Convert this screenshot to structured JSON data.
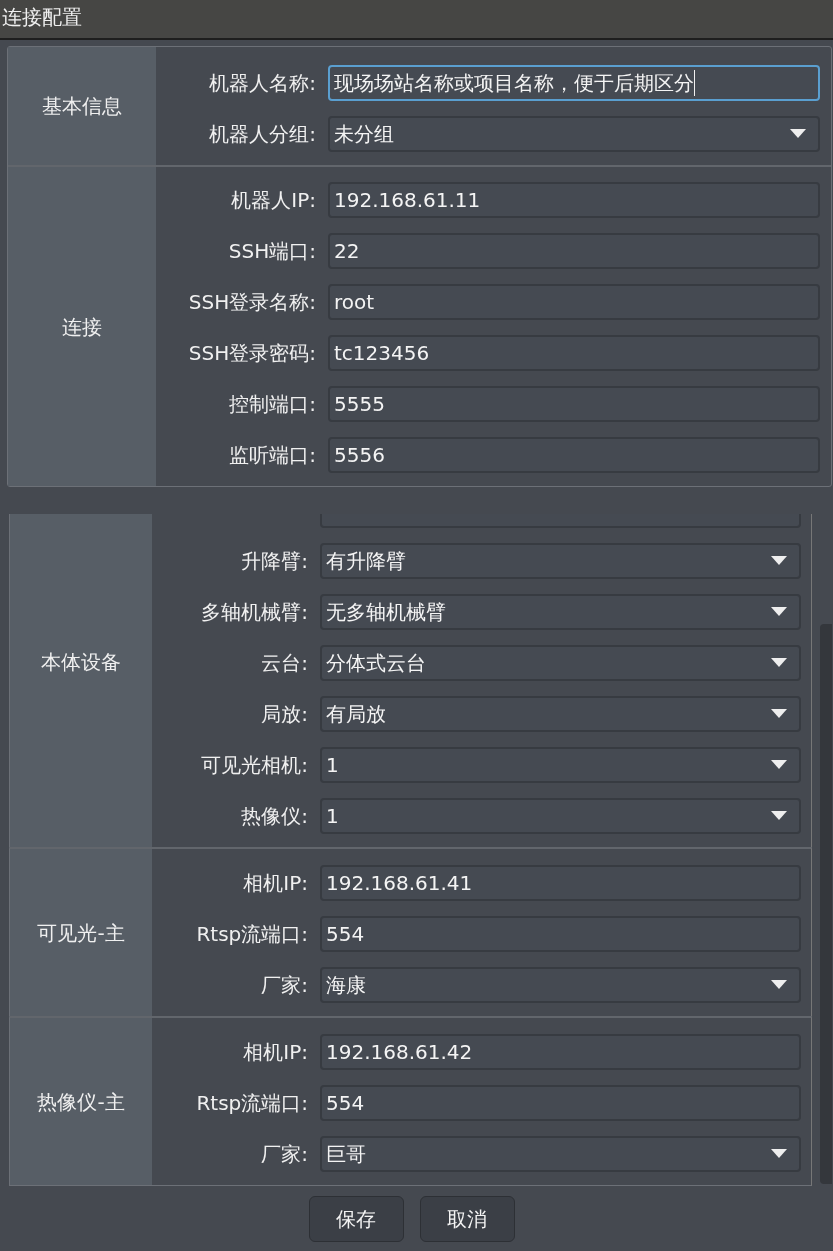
{
  "window": {
    "title": "连接配置"
  },
  "top_sections": [
    {
      "title": "基本信息",
      "fields": [
        {
          "label": "机器人名称:",
          "kind": "text",
          "value": "现场场站名称或项目名称，便于后期区分",
          "focused": true
        },
        {
          "label": "机器人分组:",
          "kind": "select",
          "value": "未分组",
          "focused": false
        }
      ]
    },
    {
      "title": "连接",
      "fields": [
        {
          "label": "机器人IP:",
          "kind": "text",
          "value": "192.168.61.11",
          "focused": false
        },
        {
          "label": "SSH端口:",
          "kind": "text",
          "value": "22",
          "focused": false
        },
        {
          "label": "SSH登录名称:",
          "kind": "text",
          "value": "root",
          "focused": false
        },
        {
          "label": "SSH登录密码:",
          "kind": "text",
          "value": "tc123456",
          "focused": false
        },
        {
          "label": "控制端口:",
          "kind": "text",
          "value": "5555",
          "focused": false
        },
        {
          "label": "监听端口:",
          "kind": "text",
          "value": "5556",
          "focused": false
        }
      ]
    }
  ],
  "scroll_sections": [
    {
      "title": "本体设备",
      "fields": [
        {
          "kind": "cut"
        },
        {
          "label": "升降臂:",
          "kind": "select",
          "value": "有升降臂",
          "focused": false
        },
        {
          "label": "多轴机械臂:",
          "kind": "select",
          "value": "无多轴机械臂",
          "focused": false
        },
        {
          "label": "云台:",
          "kind": "select",
          "value": "分体式云台",
          "focused": false
        },
        {
          "label": "局放:",
          "kind": "select",
          "value": "有局放",
          "focused": false
        },
        {
          "label": "可见光相机:",
          "kind": "select",
          "value": "1",
          "focused": false
        },
        {
          "label": "热像仪:",
          "kind": "select",
          "value": "1",
          "focused": false
        }
      ]
    },
    {
      "title": "可见光-主",
      "fields": [
        {
          "label": "相机IP:",
          "kind": "text",
          "value": "192.168.61.41",
          "focused": false
        },
        {
          "label": "Rtsp流端口:",
          "kind": "text",
          "value": "554",
          "focused": false
        },
        {
          "label": "厂家:",
          "kind": "select",
          "value": "海康",
          "focused": false
        }
      ]
    },
    {
      "title": "热像仪-主",
      "fields": [
        {
          "label": "相机IP:",
          "kind": "text",
          "value": "192.168.61.42",
          "focused": false
        },
        {
          "label": "Rtsp流端口:",
          "kind": "text",
          "value": "554",
          "focused": false
        },
        {
          "label": "厂家:",
          "kind": "select",
          "value": "巨哥",
          "focused": false
        }
      ]
    }
  ],
  "buttons": [
    "保存",
    "取消"
  ]
}
